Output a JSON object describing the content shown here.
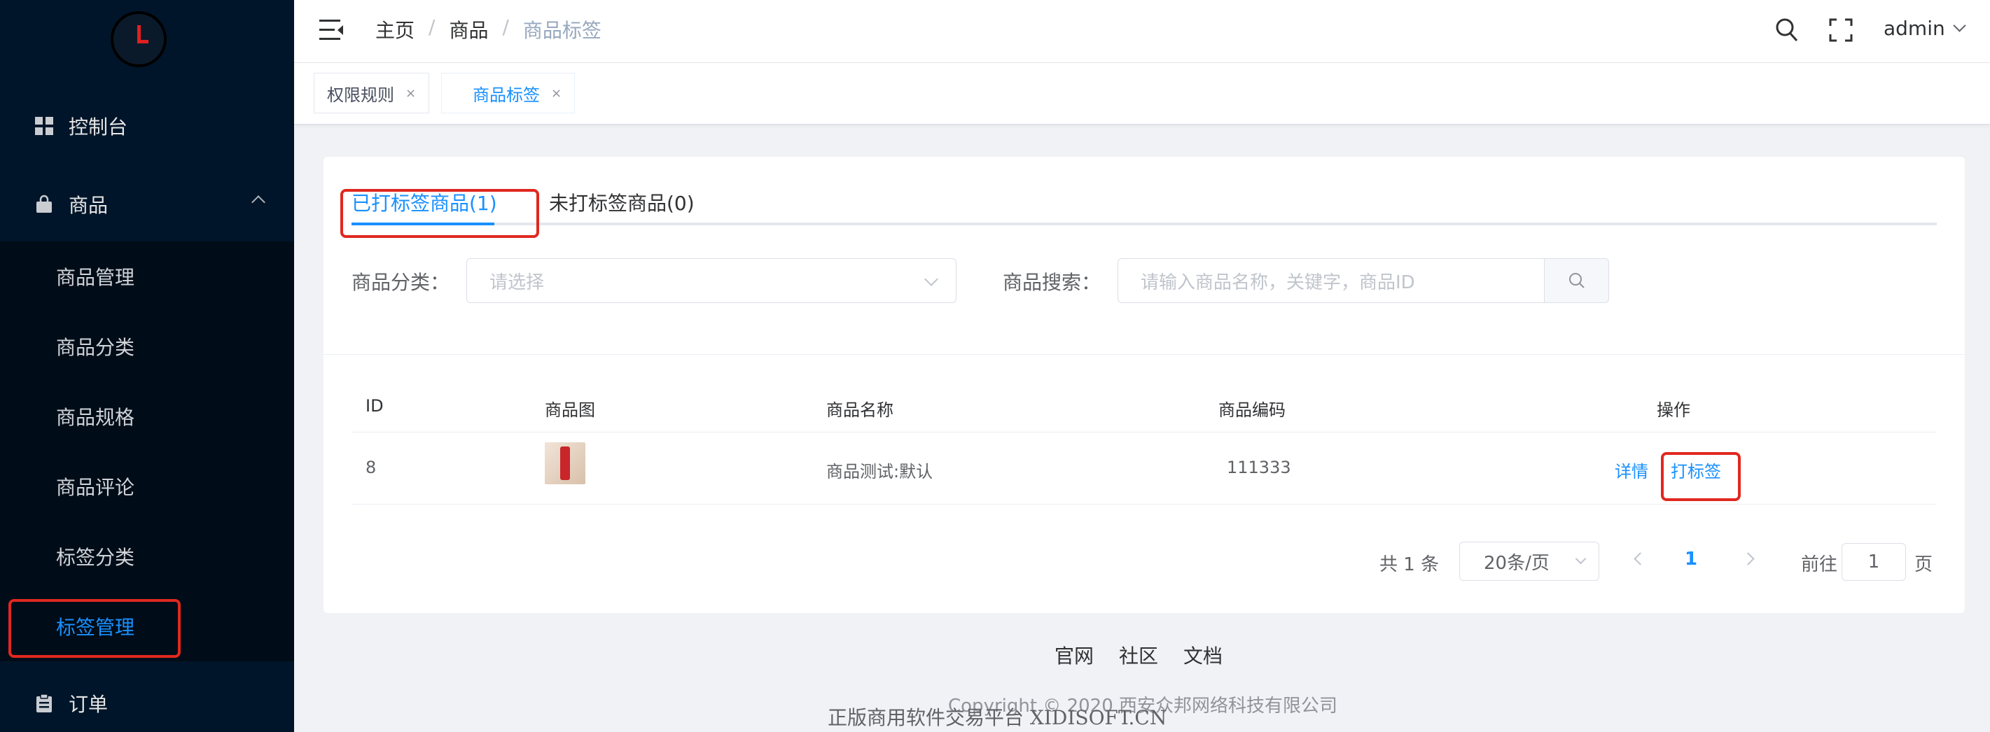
{
  "sidebar": {
    "menu": [
      {
        "label": "控制台",
        "icon": "dashboard-icon"
      },
      {
        "label": "商品",
        "icon": "shopping-bag-icon",
        "expanded": true
      },
      {
        "label": "订单",
        "icon": "clipboard-icon"
      }
    ],
    "submenu": [
      "商品管理",
      "商品分类",
      "商品规格",
      "商品评论",
      "标签分类",
      "标签管理"
    ],
    "active_submenu": "标签管理"
  },
  "header": {
    "breadcrumb": [
      "主页",
      "商品",
      "商品标签"
    ],
    "user": "admin"
  },
  "tags": [
    {
      "label": "权限规则",
      "close": "×"
    },
    {
      "label": "商品标签",
      "close": "×"
    }
  ],
  "card": {
    "tabs": [
      {
        "label": "已打标签商品(1)"
      },
      {
        "label": "未打标签商品(0)"
      }
    ],
    "filter": {
      "category_label": "商品分类：",
      "category_placeholder": "请选择",
      "search_label": "商品搜索：",
      "search_placeholder": "请输入商品名称，关键字，商品ID"
    },
    "table": {
      "headers": [
        "ID",
        "商品图",
        "商品名称",
        "商品编码",
        "操作"
      ],
      "rows": [
        {
          "id": "8",
          "name": "商品测试:默认",
          "code": "111333",
          "actions": [
            "详情",
            "打标签"
          ]
        }
      ]
    },
    "pagination": {
      "total": "共 1 条",
      "page_size": "20条/页",
      "current": "1",
      "goto_label": "前往",
      "goto_value": "1",
      "page_suffix": "页"
    }
  },
  "footer": {
    "links": [
      "官网",
      "社区",
      "文档"
    ],
    "copyright": "Copyright © 2020 西安众邦网络科技有限公司",
    "slogan": "正版商用软件交易平台 XIDISOFT.CN"
  },
  "colors": {
    "sidebar_bg": "#001529",
    "accent": "#1890ff",
    "highlight": "#e0281f"
  }
}
